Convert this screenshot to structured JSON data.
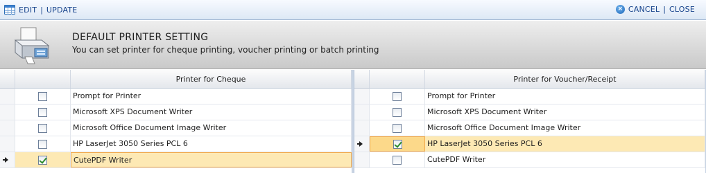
{
  "toolbar": {
    "edit_label": "EDIT",
    "update_label": "UPDATE",
    "separator": "|",
    "cancel_label": "CANCEL",
    "close_label": "CLOSE",
    "grid_icon": "grid-icon",
    "cancel_icon": "cancel-icon"
  },
  "banner": {
    "title": "DEFAULT PRINTER SETTING",
    "subtitle": "You can set printer for cheque printing, voucher printing or batch printing",
    "icon": "printer-icon"
  },
  "cheque_grid": {
    "header": "Printer for Cheque",
    "rows": [
      {
        "name": "Prompt for Printer",
        "checked": false,
        "current": false
      },
      {
        "name": "Microsoft XPS Document Writer",
        "checked": false,
        "current": false
      },
      {
        "name": "Microsoft Office Document Image Writer",
        "checked": false,
        "current": false
      },
      {
        "name": "HP LaserJet 3050 Series PCL 6",
        "checked": false,
        "current": false
      },
      {
        "name": "CutePDF Writer",
        "checked": true,
        "current": true
      }
    ]
  },
  "voucher_grid": {
    "header": "Printer for Voucher/Receipt",
    "rows": [
      {
        "name": "Prompt for Printer",
        "checked": false,
        "current": false
      },
      {
        "name": "Microsoft XPS Document Writer",
        "checked": false,
        "current": false
      },
      {
        "name": "Microsoft Office Document Image Writer",
        "checked": false,
        "current": false
      },
      {
        "name": "HP LaserJet 3050 Series PCL 6",
        "checked": true,
        "current": true
      },
      {
        "name": "CutePDF Writer",
        "checked": false,
        "current": false
      }
    ]
  },
  "colors": {
    "selected_row": "#fde9b4",
    "focus_border": "#f2a94a",
    "toolbar_text": "#15428b"
  }
}
